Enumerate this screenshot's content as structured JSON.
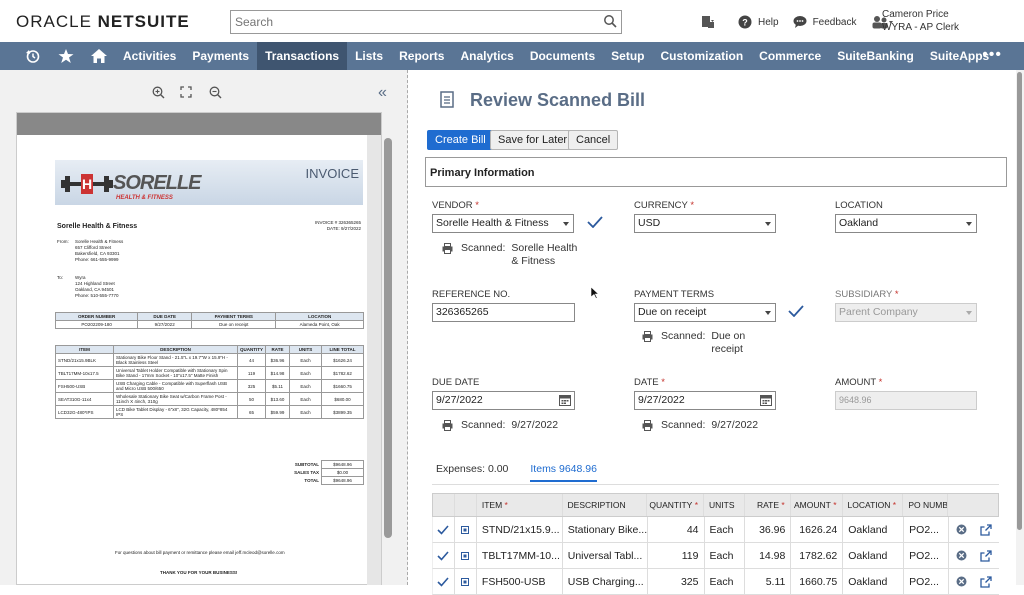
{
  "header": {
    "logo_light": "ORACLE ",
    "logo_bold": "NETSUITE",
    "search_placeholder": "Search",
    "help": "Help",
    "feedback": "Feedback",
    "user_name": "Cameron Price",
    "user_role": "WYRA - AP Clerk"
  },
  "nav": {
    "items": [
      "Activities",
      "Payments",
      "Transactions",
      "Lists",
      "Reports",
      "Analytics",
      "Documents",
      "Setup",
      "Customization",
      "Commerce",
      "SuiteBanking",
      "SuiteApps"
    ],
    "active": "Transactions",
    "more": "•••"
  },
  "invoice": {
    "title": "INVOICE",
    "brand": "SORELLE",
    "brand_sub": "HEALTH & FITNESS",
    "invoice_no": "INVOICE # 326365265",
    "date": "DATE: 9/27/2022",
    "company": "Sorelle Health & Fitness",
    "from_label": "From:",
    "from_lines": [
      "Sorelle Health & Fitness",
      "657 Clifford Street",
      "Bakersfield, CA 93301",
      "Phone: 661-555-9999"
    ],
    "to_label": "To:",
    "to_lines": [
      "Wyra",
      "124 Highland Street",
      "Oakland, CA 94501",
      "Phone: 510-555-7770"
    ],
    "order_headers": [
      "ORDER NUMBER",
      "DUE DATE",
      "PAYMENT TERMS",
      "LOCATION"
    ],
    "order_values": [
      "PO202209-180",
      "9/27/2022",
      "Due on receipt",
      "Alameda Point, Oak"
    ],
    "line_headers": [
      "ITEM",
      "DESCRIPTION",
      "QUANTITY",
      "RATE",
      "UNITS",
      "LINE TOTAL"
    ],
    "lines": [
      [
        "STND/21x15.9BLK",
        "Stationary Bike Floor Stand - 21.5\"L x 19.7\"W x 15.9\"H - Black Stainless Steel",
        "44",
        "$36.96",
        "Each",
        "$1626.24"
      ],
      [
        "TBLT17MM-10x17.5",
        "Universal Tablet Holder Compatible with Stationary Spin Bike Stand - 17mm Socket - 10\"x17.5\" Matte Finish",
        "119",
        "$14.98",
        "Each",
        "$1782.62"
      ],
      [
        "FSH500-USB",
        "USB Charging Cable - Compatible with Superflash USB and Micro USB 500/650",
        "325",
        "$5.11",
        "Each",
        "$1660.75"
      ],
      [
        "SEAT310G-11x4",
        "Wholesale Stationary Bike Seat w/Carbon Frame Post - 11inch X 4inch, 310g",
        "50",
        "$13.60",
        "Each",
        "$680.00"
      ],
      [
        "LCD32G-480*IPS",
        "LCD Bike Tablet Display - 6\"x8\", 32G Capacity, 480*854 IPS",
        "65",
        "$59.99",
        "Each",
        "$3899.35"
      ]
    ],
    "subtotal_label": "SUBTOTAL",
    "subtotal": "$9648.96",
    "tax_label": "SALES TAX",
    "tax": "$0.00",
    "total_label": "TOTAL",
    "total": "$9648.96",
    "footer_q": "For questions about bill payment or remittance please email jeff.mcleod@sorelle.com",
    "footer_thanks": "THANK YOU FOR YOUR BUSINESS!"
  },
  "form": {
    "title": "Review Scanned Bill",
    "buttons": {
      "create": "Create Bill",
      "save": "Save for Later",
      "cancel": "Cancel"
    },
    "section": "Primary Information",
    "vendor_label": "VENDOR",
    "vendor": "Sorelle Health & Fitness",
    "vendor_scanned": "Sorelle Health & Fitness",
    "currency_label": "CURRENCY",
    "currency": "USD",
    "location_label": "LOCATION",
    "location": "Oakland",
    "ref_label": "REFERENCE NO.",
    "ref": "326365265",
    "terms_label": "PAYMENT TERMS",
    "terms": "Due on receipt",
    "terms_scanned": "Due on receipt",
    "subsidiary_label": "SUBSIDIARY",
    "subsidiary": "Parent Company",
    "due_label": "DUE DATE",
    "due": "9/27/2022",
    "due_scanned": "9/27/2022",
    "date_label": "DATE",
    "date": "9/27/2022",
    "date_scanned": "9/27/2022",
    "amount_label": "AMOUNT",
    "amount": "9648.96",
    "scanned_label": "Scanned:",
    "req": "*"
  },
  "subtabs": {
    "expenses": "Expenses: 0.00",
    "items": "Items 9648.96"
  },
  "items_table": {
    "headers": [
      "ITEM",
      "DESCRIPTION",
      "QUANTITY",
      "UNITS",
      "RATE",
      "AMOUNT",
      "LOCATION",
      "PO NUMBER"
    ],
    "rows": [
      [
        "STND/21x15.9...",
        "Stationary Bike...",
        "44",
        "Each",
        "36.96",
        "1626.24",
        "Oakland",
        "PO2..."
      ],
      [
        "TBLT17MM-10...",
        "Universal Tabl...",
        "119",
        "Each",
        "14.98",
        "1782.62",
        "Oakland",
        "PO2..."
      ],
      [
        "FSH500-USB",
        "USB Charging...",
        "325",
        "Each",
        "5.11",
        "1660.75",
        "Oakland",
        "PO2..."
      ]
    ]
  },
  "colors": {
    "nav": "#5a7595",
    "nav_active": "#3f5570",
    "primary": "#1f6cd0",
    "title": "#5a6d86",
    "required": "#c4312b"
  }
}
